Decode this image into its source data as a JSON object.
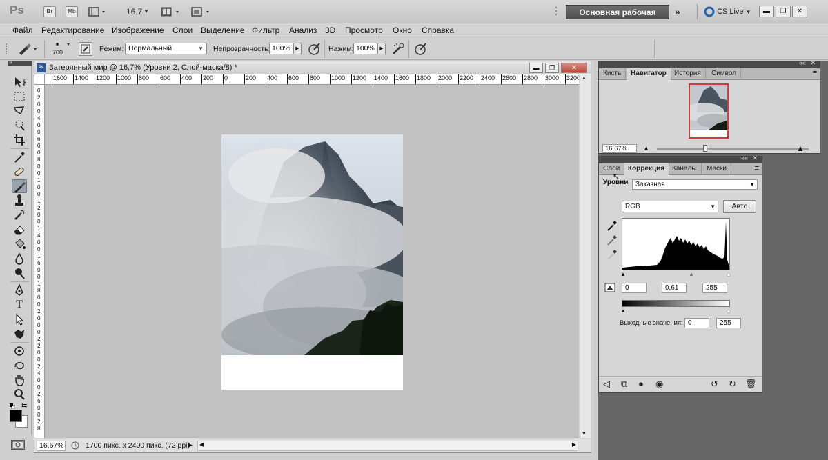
{
  "appbar": {
    "logo": "Ps",
    "br": "Br",
    "mb": "Mb",
    "zoom": "16,7",
    "workspace": "Основная рабочая среда",
    "cslive": "CS Live",
    "window_controls": [
      "minimize-icon",
      "maximize-icon",
      "close-icon"
    ]
  },
  "menu": [
    "Файл",
    "Редактирование",
    "Изображение",
    "Слои",
    "Выделение",
    "Фильтр",
    "Анализ",
    "3D",
    "Просмотр",
    "Окно",
    "Справка"
  ],
  "options": {
    "brush_size": "700",
    "mode_label": "Режим:",
    "mode_value": "Нормальный",
    "opacity_label": "Непрозрачность:",
    "opacity_value": "100%",
    "pressure_label": "Нажим:",
    "pressure_value": "100%"
  },
  "document": {
    "title": "Затерянный мир @ 16,7% (Уровни 2, Слой-маска/8) *",
    "ruler_h": [
      "1600",
      "1400",
      "1200",
      "1000",
      "800",
      "600",
      "400",
      "200",
      "0",
      "200",
      "400",
      "600",
      "800",
      "1000",
      "1200",
      "1400",
      "1600",
      "1800",
      "2000",
      "2200",
      "2400",
      "2600",
      "2800",
      "3000",
      "3200"
    ],
    "ruler_v": [
      "0",
      "2",
      "0",
      "0",
      "4",
      "0",
      "0",
      "6",
      "0",
      "0",
      "8",
      "0",
      "0",
      "1",
      "0",
      "0",
      "1",
      "2",
      "0",
      "0",
      "1",
      "4",
      "0",
      "0",
      "1",
      "6",
      "0",
      "0",
      "1",
      "8",
      "0",
      "0",
      "2",
      "0",
      "0",
      "0",
      "2",
      "2",
      "0",
      "0",
      "2",
      "4",
      "0",
      "0",
      "2",
      "6",
      "0",
      "0",
      "2",
      "8"
    ],
    "status_zoom": "16,67%",
    "status_info": "1700 пикс. x 2400 пикс. (72 ppi)"
  },
  "navigator": {
    "tabs": [
      "Кисть",
      "Навигатор",
      "История",
      "Символ"
    ],
    "active": "Навигатор",
    "zoom": "16.67%"
  },
  "adjustments": {
    "tabs": [
      "Слои",
      "Коррекция",
      "Каналы",
      "Маски"
    ],
    "active": "Коррекция",
    "title": "Уровни",
    "preset": "Заказная",
    "channel": "RGB",
    "auto_label": "Авто",
    "input_black": "0",
    "input_mid": "0,61",
    "input_white": "255",
    "output_label": "Выходные значения:",
    "output_black": "0",
    "output_white": "255"
  }
}
